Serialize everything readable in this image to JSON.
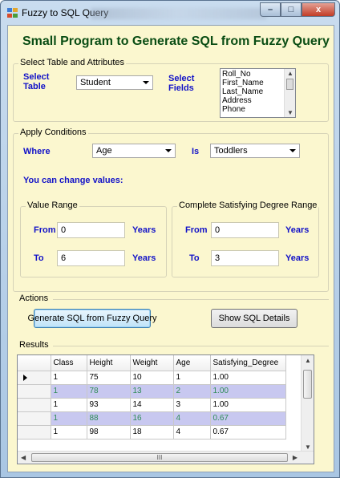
{
  "window": {
    "title": "Fuzzy to SQL Query",
    "controls": {
      "minimize": "–",
      "maximize": "□",
      "close": "x"
    }
  },
  "header": {
    "title": "Small Program to Generate SQL from Fuzzy Query"
  },
  "select_section": {
    "legend": "Select Table and Attributes",
    "table_label": "Select Table",
    "table_value": "Student",
    "fields_label": "Select Fields",
    "fields": [
      "Roll_No",
      "First_Name",
      "Last_Name",
      "Address",
      "Phone"
    ]
  },
  "conditions": {
    "legend": "Apply Conditions",
    "where_label": "Where",
    "where_value": "Age",
    "is_label": "Is",
    "is_value": "Toddlers",
    "hint": "You can change values:",
    "value_range": {
      "legend": "Value Range",
      "from_label": "From",
      "from_value": "0",
      "to_label": "To",
      "to_value": "6",
      "unit": "Years"
    },
    "degree_range": {
      "legend": "Complete Satisfying Degree Range",
      "from_label": "From",
      "from_value": "0",
      "to_label": "To",
      "to_value": "3",
      "unit": "Years"
    }
  },
  "actions": {
    "label": "Actions",
    "generate_button": "Generate SQL from Fuzzy Query",
    "details_button": "Show SQL Details"
  },
  "results": {
    "label": "Results",
    "columns": [
      "Class",
      "Height",
      "Weight",
      "Age",
      "Satisfying_Degree"
    ],
    "rows": [
      [
        "1",
        "75",
        "10",
        "1",
        "1.00"
      ],
      [
        "1",
        "78",
        "13",
        "2",
        "1.00"
      ],
      [
        "1",
        "93",
        "14",
        "3",
        "1.00"
      ],
      [
        "1",
        "88",
        "16",
        "4",
        "0.67"
      ],
      [
        "1",
        "98",
        "18",
        "4",
        "0.67"
      ]
    ],
    "hscroll_grip": "III"
  },
  "colors": {
    "client_bg": "#fbf7cf",
    "title_green": "#0a4d14",
    "label_blue": "#1212c8",
    "alt_row_bg": "#c8c8f0",
    "alt_row_text": "#2e8b57"
  }
}
